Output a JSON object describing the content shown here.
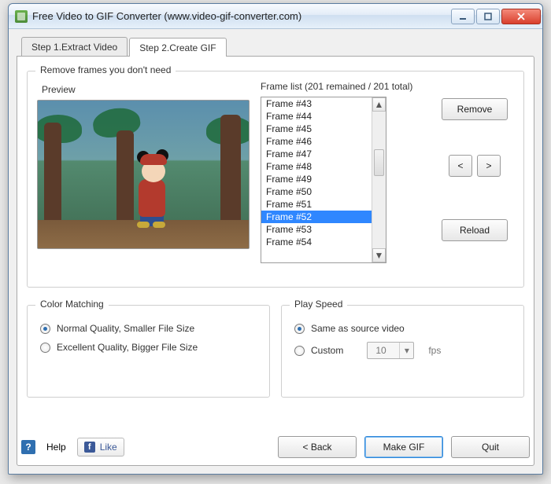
{
  "titlebar": {
    "title": "Free Video to GIF Converter (www.video-gif-converter.com)"
  },
  "tabs": {
    "extract": "Step 1.Extract Video",
    "create": "Step 2.Create GIF"
  },
  "remove_group": {
    "legend": "Remove frames you don't need",
    "preview_label": "Preview",
    "list_label": "Frame list (201 remained / 201 total)",
    "frames": [
      "Frame #43",
      "Frame #44",
      "Frame #45",
      "Frame #46",
      "Frame #47",
      "Frame #48",
      "Frame #49",
      "Frame #50",
      "Frame #51",
      "Frame #52",
      "Frame #53",
      "Frame #54"
    ],
    "selected_index": 9,
    "buttons": {
      "remove": "Remove",
      "prev": "<",
      "next": ">",
      "reload": "Reload"
    }
  },
  "color_group": {
    "legend": "Color Matching",
    "normal": "Normal Quality, Smaller File Size",
    "excellent": "Excellent Quality, Bigger File Size",
    "selected": "normal"
  },
  "speed_group": {
    "legend": "Play Speed",
    "same": "Same as source video",
    "custom": "Custom",
    "selected": "same",
    "fps_value": "10",
    "fps_unit": "fps"
  },
  "footer": {
    "help": "Help",
    "like": "Like",
    "back": "< Back",
    "make": "Make GIF",
    "quit": "Quit"
  }
}
